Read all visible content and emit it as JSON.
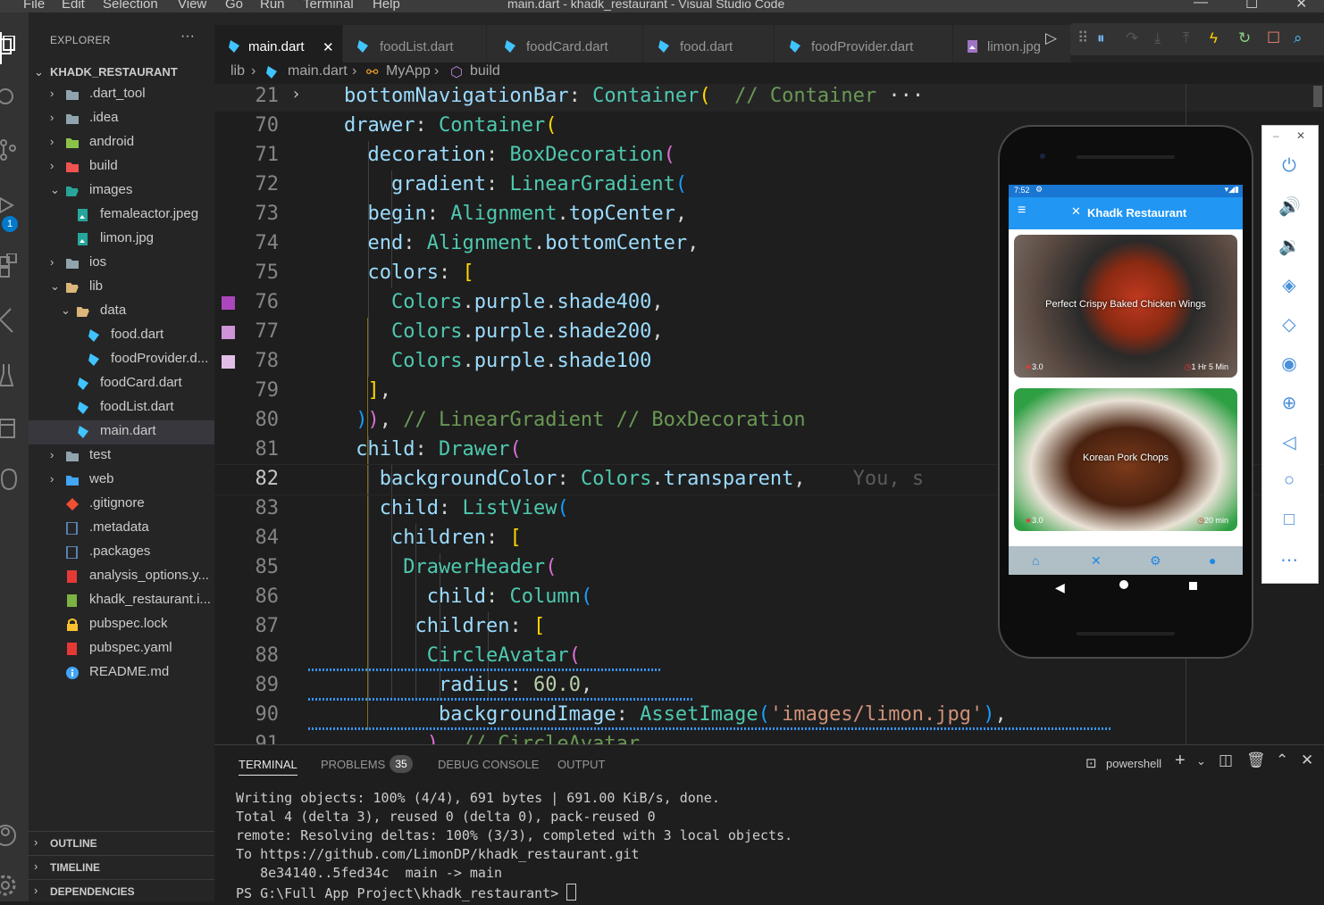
{
  "menu": [
    "File",
    "Edit",
    "Selection",
    "View",
    "Go",
    "Run",
    "Terminal",
    "Help"
  ],
  "window_title": "main.dart - khadk_restaurant - Visual Studio Code",
  "explorer": {
    "title": "EXPLORER",
    "more": "···",
    "project": "KHADK_RESTAURANT",
    "items": [
      {
        "label": ".dart_tool",
        "type": "folder",
        "expanded": false,
        "level": 0
      },
      {
        "label": ".idea",
        "type": "folder",
        "expanded": false,
        "level": 0
      },
      {
        "label": "android",
        "type": "folder",
        "expanded": false,
        "level": 0
      },
      {
        "label": "build",
        "type": "folder",
        "expanded": false,
        "level": 0
      },
      {
        "label": "images",
        "type": "folder",
        "expanded": true,
        "level": 0
      },
      {
        "label": "femaleactor.jpeg",
        "type": "image",
        "level": 1
      },
      {
        "label": "limon.jpg",
        "type": "image",
        "level": 1
      },
      {
        "label": "ios",
        "type": "folder",
        "expanded": false,
        "level": 0
      },
      {
        "label": "lib",
        "type": "folder",
        "expanded": true,
        "level": 0
      },
      {
        "label": "data",
        "type": "folder",
        "expanded": true,
        "level": 1
      },
      {
        "label": "food.dart",
        "type": "dart",
        "level": 2
      },
      {
        "label": "foodProvider.d...",
        "type": "dart",
        "level": 2
      },
      {
        "label": "foodCard.dart",
        "type": "dart",
        "level": 1
      },
      {
        "label": "foodList.dart",
        "type": "dart",
        "level": 1
      },
      {
        "label": "main.dart",
        "type": "dart",
        "level": 1,
        "selected": true
      },
      {
        "label": "test",
        "type": "folder",
        "expanded": false,
        "level": 0
      },
      {
        "label": "web",
        "type": "folder",
        "expanded": false,
        "level": 0
      },
      {
        "label": ".gitignore",
        "type": "git",
        "level": 0
      },
      {
        "label": ".metadata",
        "type": "file",
        "level": 0
      },
      {
        "label": ".packages",
        "type": "file",
        "level": 0
      },
      {
        "label": "analysis_options.y...",
        "type": "yaml",
        "level": 0
      },
      {
        "label": "khadk_restaurant.i...",
        "type": "iml",
        "level": 0
      },
      {
        "label": "pubspec.lock",
        "type": "lock",
        "level": 0
      },
      {
        "label": "pubspec.yaml",
        "type": "yaml",
        "level": 0
      },
      {
        "label": "README.md",
        "type": "info",
        "level": 0
      }
    ],
    "sections": [
      "OUTLINE",
      "TIMELINE",
      "DEPENDENCIES"
    ]
  },
  "activity_badge": "1",
  "tabs": [
    {
      "label": "main.dart",
      "active": true,
      "close": "✕"
    },
    {
      "label": "foodList.dart",
      "active": false
    },
    {
      "label": "foodCard.dart",
      "active": false
    },
    {
      "label": "food.dart",
      "active": false
    },
    {
      "label": "foodProvider.dart",
      "active": false
    },
    {
      "label": "limon.jpg",
      "active": false
    }
  ],
  "breadcrumb": [
    "lib",
    "main.dart",
    "MyApp",
    "build"
  ],
  "code": [
    {
      "ln": "21",
      "tokens": [
        [
          "k-prop",
          "bottomNavigationBar"
        ],
        [
          "k-punc",
          ": "
        ],
        [
          "k-class",
          "Container"
        ],
        [
          "k-br1",
          "("
        ],
        [
          "k-punc",
          "  "
        ],
        [
          "k-com",
          "// Container"
        ],
        [
          "k-punc",
          " ···"
        ]
      ]
    },
    {
      "ln": "70",
      "tokens": [
        [
          "k-prop",
          "drawer"
        ],
        [
          "k-punc",
          ": "
        ],
        [
          "k-class",
          "Container"
        ],
        [
          "k-br1",
          "("
        ]
      ]
    },
    {
      "ln": "71",
      "tokens": [
        [
          "k-punc",
          "  "
        ],
        [
          "k-prop",
          "decoration"
        ],
        [
          "k-punc",
          ": "
        ],
        [
          "k-class",
          "BoxDecoration"
        ],
        [
          "k-br2",
          "("
        ]
      ]
    },
    {
      "ln": "72",
      "tokens": [
        [
          "k-punc",
          "    "
        ],
        [
          "k-prop",
          "gradient"
        ],
        [
          "k-punc",
          ": "
        ],
        [
          "k-class",
          "LinearGradient"
        ],
        [
          "k-br3",
          "("
        ]
      ]
    },
    {
      "ln": "73",
      "tokens": [
        [
          "k-punc",
          "  "
        ],
        [
          "k-prop",
          "begin"
        ],
        [
          "k-punc",
          ": "
        ],
        [
          "k-class",
          "Alignment"
        ],
        [
          "k-punc",
          "."
        ],
        [
          "k-prop",
          "topCenter"
        ],
        [
          "k-punc",
          ","
        ]
      ]
    },
    {
      "ln": "74",
      "tokens": [
        [
          "k-punc",
          "  "
        ],
        [
          "k-prop",
          "end"
        ],
        [
          "k-punc",
          ": "
        ],
        [
          "k-class",
          "Alignment"
        ],
        [
          "k-punc",
          "."
        ],
        [
          "k-prop",
          "bottomCenter"
        ],
        [
          "k-punc",
          ","
        ]
      ]
    },
    {
      "ln": "75",
      "tokens": [
        [
          "k-punc",
          "  "
        ],
        [
          "k-prop",
          "colors"
        ],
        [
          "k-punc",
          ": "
        ],
        [
          "k-br1",
          "["
        ]
      ]
    },
    {
      "ln": "76",
      "tokens": [
        [
          "k-punc",
          "    "
        ],
        [
          "k-class",
          "Colors"
        ],
        [
          "k-punc",
          "."
        ],
        [
          "k-prop",
          "purple"
        ],
        [
          "k-punc",
          "."
        ],
        [
          "k-prop",
          "shade400"
        ],
        [
          "k-punc",
          ","
        ]
      ],
      "swatch": "#ab47bc"
    },
    {
      "ln": "77",
      "tokens": [
        [
          "k-punc",
          "    "
        ],
        [
          "k-class",
          "Colors"
        ],
        [
          "k-punc",
          "."
        ],
        [
          "k-prop",
          "purple"
        ],
        [
          "k-punc",
          "."
        ],
        [
          "k-prop",
          "shade200"
        ],
        [
          "k-punc",
          ","
        ]
      ],
      "swatch": "#ce93d8"
    },
    {
      "ln": "78",
      "tokens": [
        [
          "k-punc",
          "    "
        ],
        [
          "k-class",
          "Colors"
        ],
        [
          "k-punc",
          "."
        ],
        [
          "k-prop",
          "purple"
        ],
        [
          "k-punc",
          "."
        ],
        [
          "k-prop",
          "shade100"
        ]
      ],
      "swatch": "#e1bee7"
    },
    {
      "ln": "79",
      "tokens": [
        [
          "k-punc",
          "  "
        ],
        [
          "k-br1",
          "]"
        ],
        [
          "k-punc",
          ","
        ]
      ]
    },
    {
      "ln": "80",
      "tokens": [
        [
          "k-punc",
          " "
        ],
        [
          "k-br3",
          ")"
        ],
        [
          "k-br2",
          ")"
        ],
        [
          "k-punc",
          ", "
        ],
        [
          "k-com",
          "// LinearGradient // BoxDecoration"
        ]
      ]
    },
    {
      "ln": "81",
      "tokens": [
        [
          "k-punc",
          " "
        ],
        [
          "k-prop",
          "child"
        ],
        [
          "k-punc",
          ": "
        ],
        [
          "k-class",
          "Drawer"
        ],
        [
          "k-br2",
          "("
        ]
      ]
    },
    {
      "ln": "82",
      "tokens": [
        [
          "k-punc",
          "   "
        ],
        [
          "k-prop",
          "backgroundColor"
        ],
        [
          "k-punc",
          ": "
        ],
        [
          "k-class",
          "Colors"
        ],
        [
          "k-punc",
          "."
        ],
        [
          "k-prop",
          "transparent"
        ],
        [
          "k-punc",
          ","
        ],
        [
          "k-punc",
          "    "
        ],
        [
          "k-ghost",
          "You, s"
        ]
      ],
      "current": true
    },
    {
      "ln": "83",
      "tokens": [
        [
          "k-punc",
          "   "
        ],
        [
          "k-prop",
          "child"
        ],
        [
          "k-punc",
          ": "
        ],
        [
          "k-class",
          "ListView"
        ],
        [
          "k-br3",
          "("
        ]
      ]
    },
    {
      "ln": "84",
      "tokens": [
        [
          "k-punc",
          "    "
        ],
        [
          "k-prop",
          "children"
        ],
        [
          "k-punc",
          ": "
        ],
        [
          "k-br1",
          "["
        ]
      ]
    },
    {
      "ln": "85",
      "tokens": [
        [
          "k-punc",
          "     "
        ],
        [
          "k-class",
          "DrawerHeader"
        ],
        [
          "k-br2",
          "("
        ]
      ]
    },
    {
      "ln": "86",
      "tokens": [
        [
          "k-punc",
          "       "
        ],
        [
          "k-prop",
          "child"
        ],
        [
          "k-punc",
          ": "
        ],
        [
          "k-class",
          "Column"
        ],
        [
          "k-br3",
          "("
        ]
      ]
    },
    {
      "ln": "87",
      "tokens": [
        [
          "k-punc",
          "      "
        ],
        [
          "k-prop",
          "children"
        ],
        [
          "k-punc",
          ": "
        ],
        [
          "k-br1",
          "["
        ]
      ]
    },
    {
      "ln": "88",
      "tokens": [
        [
          "k-punc",
          "       "
        ],
        [
          "k-class",
          "CircleAvatar"
        ],
        [
          "k-br2",
          "("
        ]
      ],
      "squiggle": 395
    },
    {
      "ln": "89",
      "tokens": [
        [
          "k-punc",
          "        "
        ],
        [
          "k-prop",
          "radius"
        ],
        [
          "k-punc",
          ": "
        ],
        [
          "k-num",
          "60.0"
        ],
        [
          "k-punc",
          ","
        ]
      ],
      "squiggle": 430
    },
    {
      "ln": "90",
      "tokens": [
        [
          "k-punc",
          "        "
        ],
        [
          "k-prop",
          "backgroundImage"
        ],
        [
          "k-punc",
          ": "
        ],
        [
          "k-class",
          "AssetImage"
        ],
        [
          "k-br3",
          "("
        ],
        [
          "k-str",
          "'images/limon.jpg'"
        ],
        [
          "k-br3",
          ")"
        ],
        [
          "k-punc",
          ","
        ]
      ],
      "squiggle": 900
    },
    {
      "ln": "91",
      "tokens": [
        [
          "k-punc",
          "       "
        ],
        [
          "k-br2",
          ")"
        ],
        [
          "k-punc",
          ", "
        ],
        [
          "k-com",
          "// CircleAvatar"
        ]
      ]
    }
  ],
  "emulator": {
    "time": "7:52",
    "app_title": "Khadk Restaurant",
    "foods": [
      {
        "name": "Perfect Crispy Baked Chicken Wings",
        "rating": "3.0",
        "time": "1 Hr 5 Min"
      },
      {
        "name": "Korean Pork Chops",
        "rating": "3.0",
        "time": "20 min"
      }
    ]
  },
  "panel": {
    "tabs": [
      "TERMINAL",
      "PROBLEMS",
      "DEBUG CONSOLE",
      "OUTPUT"
    ],
    "problems_count": "35",
    "shell": "powershell",
    "lines": [
      "Writing objects: 100% (4/4), 691 bytes | 691.00 KiB/s, done.",
      "Total 4 (delta 3), reused 0 (delta 0), pack-reused 0",
      "remote: Resolving deltas: 100% (3/3), completed with 3 local objects.",
      "To https://github.com/LimonDP/khadk_restaurant.git",
      "   8e34140..5fed34c  main -> main",
      "PS G:\\Full App Project\\khadk_restaurant> "
    ]
  },
  "colors": {
    "accent": "#007acc",
    "app_blue": "#2196f3"
  }
}
